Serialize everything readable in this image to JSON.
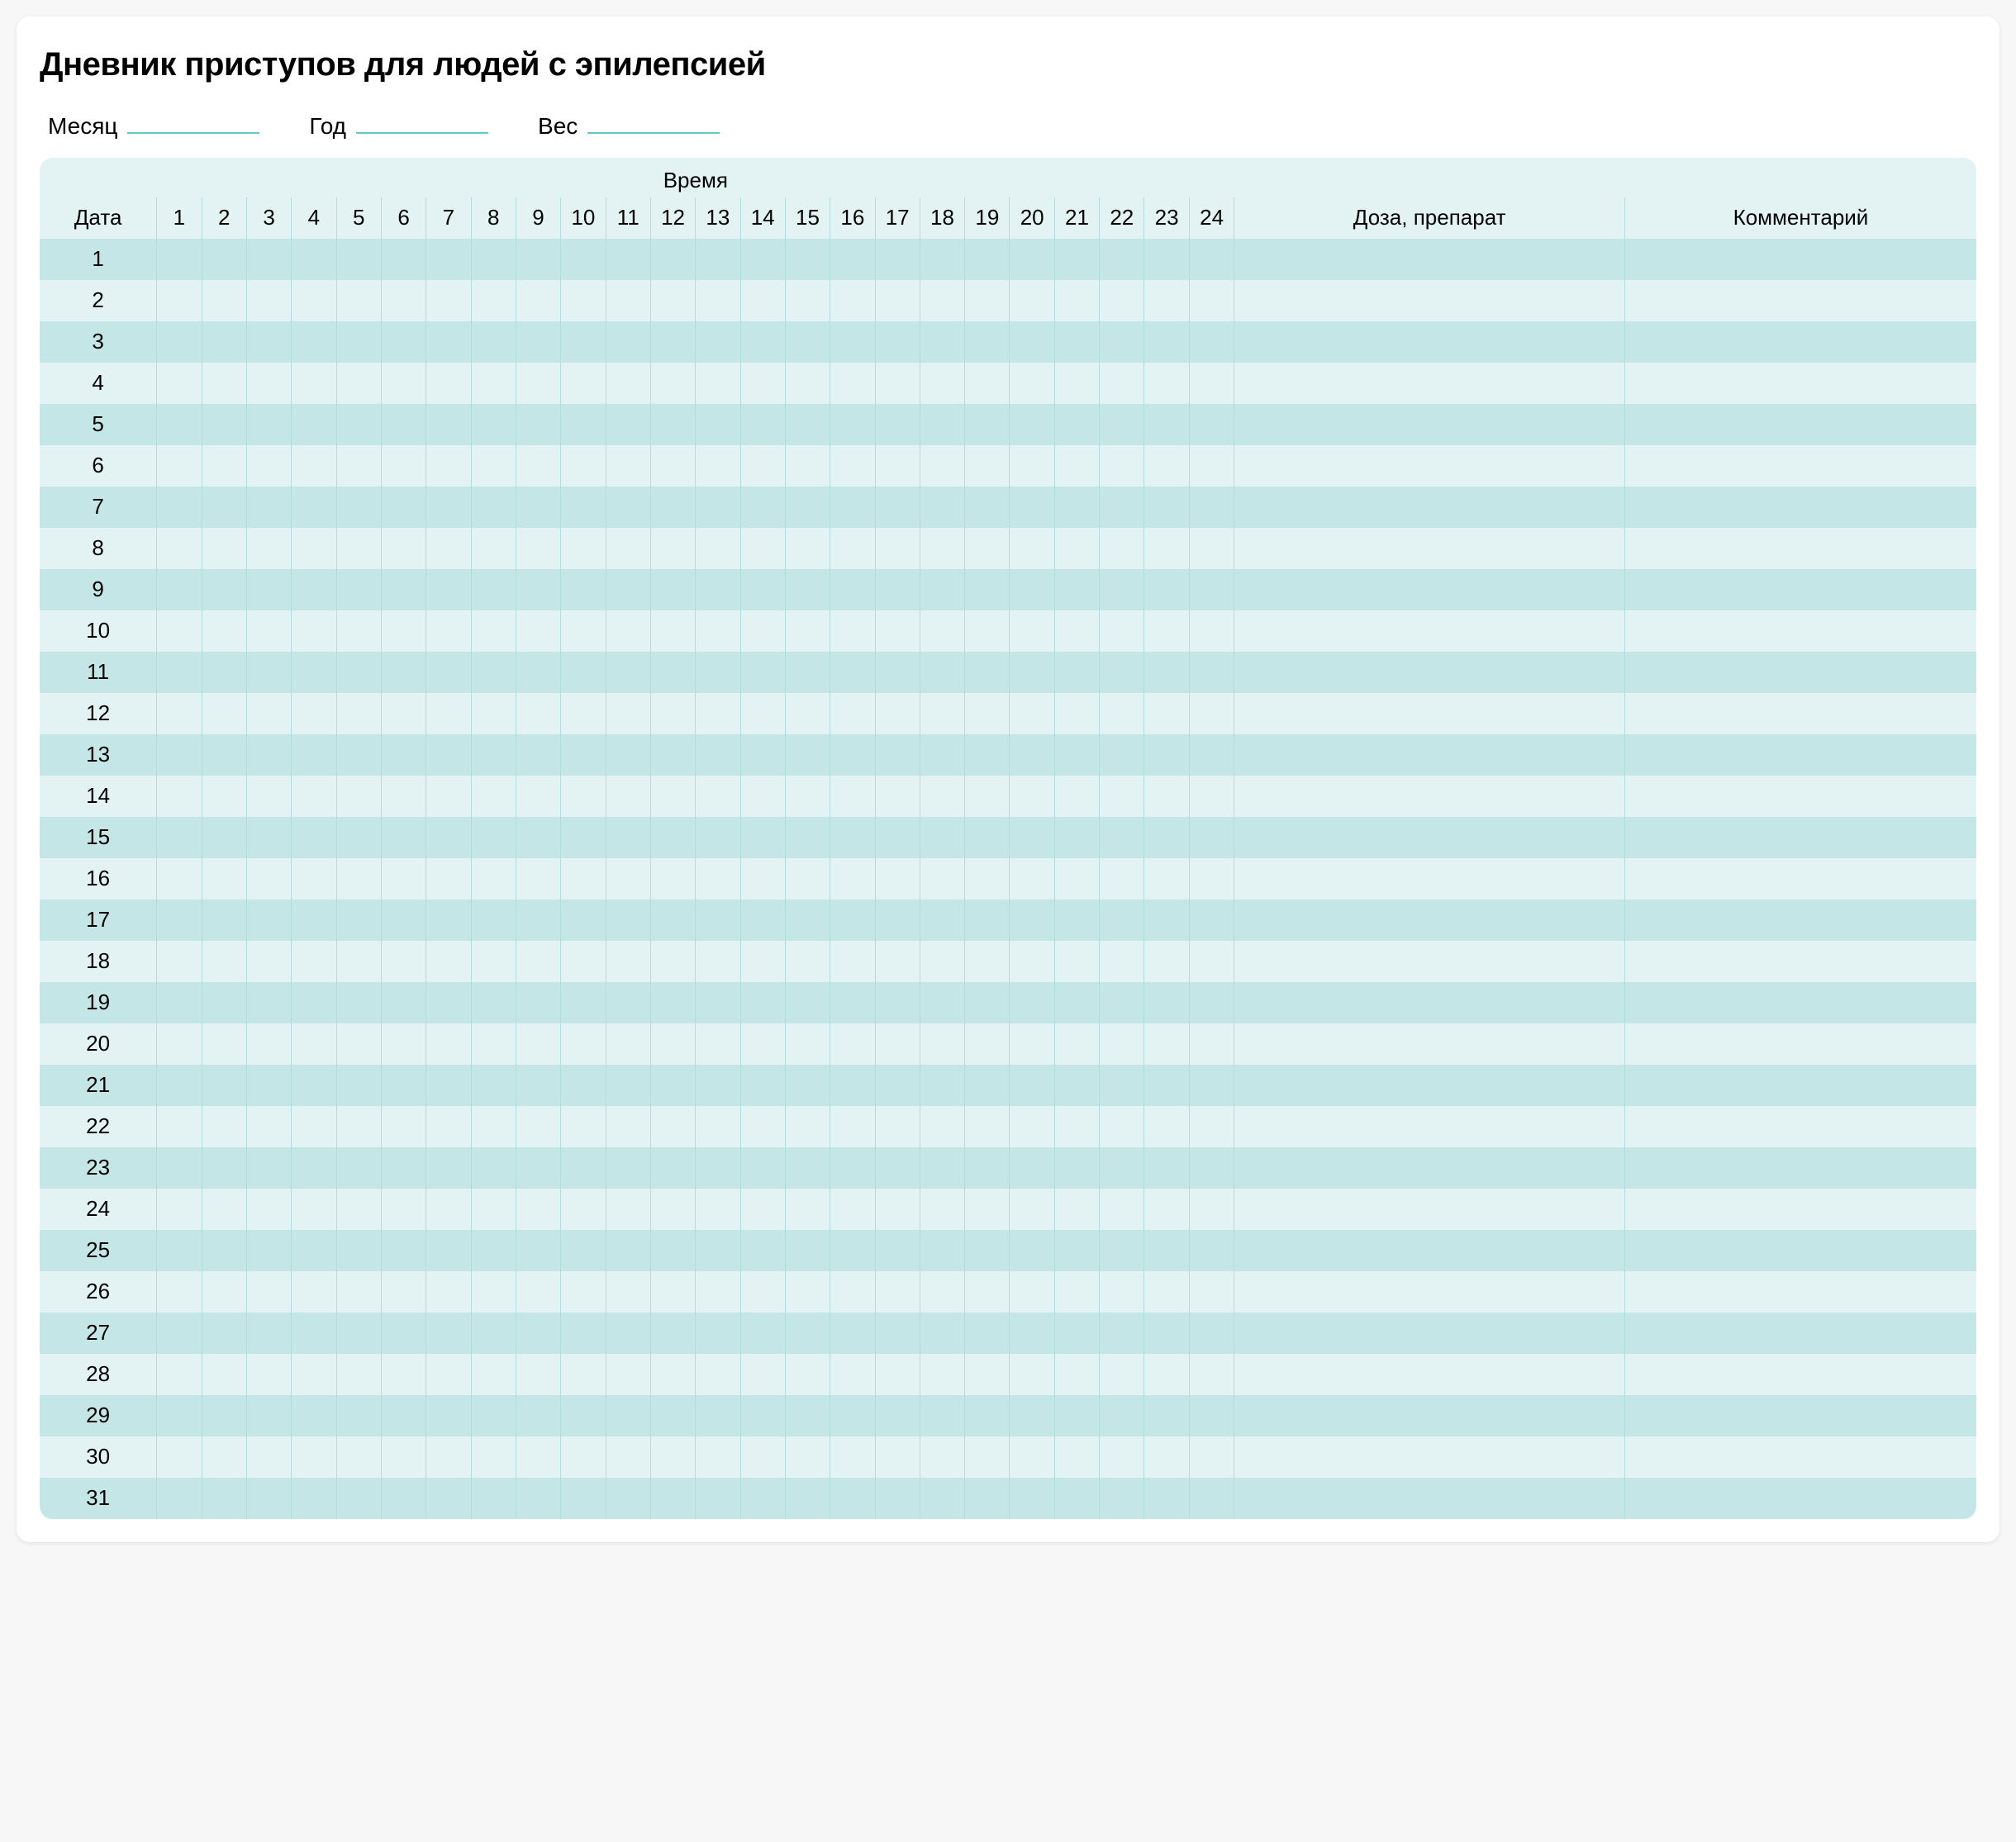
{
  "title": "Дневник приступов для людей с эпилепсией",
  "meta": {
    "month_label": "Месяц",
    "year_label": "Год",
    "weight_label": "Вес",
    "month_value": "",
    "year_value": "",
    "weight_value": ""
  },
  "headers": {
    "date": "Дата",
    "time": "Время",
    "dose": "Доза, препарат",
    "comment": "Комментарий",
    "hours": [
      "1",
      "2",
      "3",
      "4",
      "5",
      "6",
      "7",
      "8",
      "9",
      "10",
      "11",
      "12",
      "13",
      "14",
      "15",
      "16",
      "17",
      "18",
      "19",
      "20",
      "21",
      "22",
      "23",
      "24"
    ]
  },
  "days": [
    "1",
    "2",
    "3",
    "4",
    "5",
    "6",
    "7",
    "8",
    "9",
    "10",
    "11",
    "12",
    "13",
    "14",
    "15",
    "16",
    "17",
    "18",
    "19",
    "20",
    "21",
    "22",
    "23",
    "24",
    "25",
    "26",
    "27",
    "28",
    "29",
    "30",
    "31"
  ],
  "chart_data": {
    "type": "table",
    "description": "Blank monthly seizure diary. Rows = days 1–31. Columns = hours 1–24 plus 'Доза, препарат' and 'Комментарий'. All cells empty.",
    "rows": 31,
    "hour_columns": 24,
    "extra_columns": [
      "Доза, препарат",
      "Комментарий"
    ],
    "values": []
  }
}
